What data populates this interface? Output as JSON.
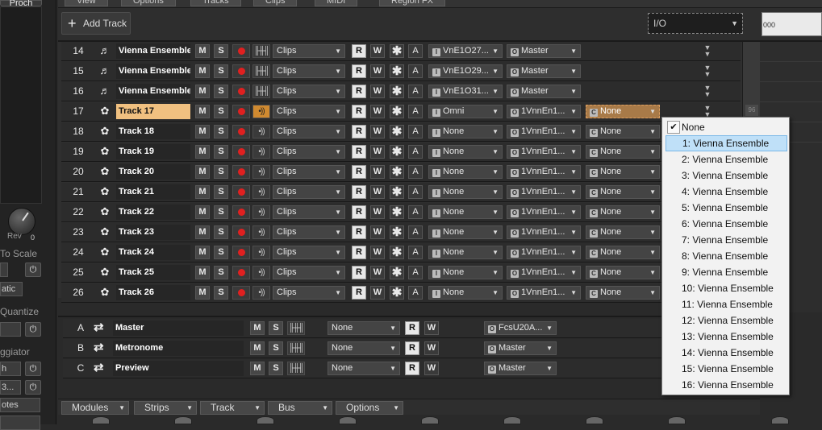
{
  "left_panel": {
    "top_label": "Proch",
    "rev_label": "Rev",
    "rev_value": "0",
    "to_scale_label": "To Scale",
    "atic_value": "atic",
    "quantize_label": "Quantize",
    "arpeggiator_label": "ggiator",
    "h_value": "h",
    "dots_value": "3...",
    "otes_value": "otes",
    "power_symbol": "⏻"
  },
  "top_menu": [
    "View",
    "Options",
    "Tracks",
    "Clips",
    "MIDI",
    "Region FX"
  ],
  "toolbar": {
    "add_track_label": "Add Track",
    "io_label": "I/O",
    "ruler_text": "000"
  },
  "buttons": {
    "mute": "M",
    "solo": "S",
    "read": "R",
    "write": "W",
    "star": "✱",
    "auto": "A",
    "clips": "Clips"
  },
  "tracks": [
    {
      "num": "14",
      "name": "Vienna Ensemble",
      "input": "VnE1O27...",
      "output": "Master",
      "channel": ""
    },
    {
      "num": "15",
      "name": "Vienna Ensemble",
      "input": "VnE1O29...",
      "output": "Master",
      "channel": ""
    },
    {
      "num": "16",
      "name": "Vienna Ensemble",
      "input": "VnE1O31...",
      "output": "Master",
      "channel": ""
    },
    {
      "num": "17",
      "name": "Track 17",
      "input": "Omni",
      "output": "1VnnEn1...",
      "channel": "None"
    },
    {
      "num": "18",
      "name": "Track 18",
      "input": "None",
      "output": "1VnnEn1...",
      "channel": "None"
    },
    {
      "num": "19",
      "name": "Track 19",
      "input": "None",
      "output": "1VnnEn1...",
      "channel": "None"
    },
    {
      "num": "20",
      "name": "Track 20",
      "input": "None",
      "output": "1VnnEn1...",
      "channel": "None"
    },
    {
      "num": "21",
      "name": "Track 21",
      "input": "None",
      "output": "1VnnEn1...",
      "channel": "None"
    },
    {
      "num": "22",
      "name": "Track 22",
      "input": "None",
      "output": "1VnnEn1...",
      "channel": "None"
    },
    {
      "num": "23",
      "name": "Track 23",
      "input": "None",
      "output": "1VnnEn1...",
      "channel": "None"
    },
    {
      "num": "24",
      "name": "Track 24",
      "input": "None",
      "output": "1VnnEn1...",
      "channel": "None"
    },
    {
      "num": "25",
      "name": "Track 25",
      "input": "None",
      "output": "1VnnEn1...",
      "channel": "None"
    },
    {
      "num": "26",
      "name": "Track 26",
      "input": "None",
      "output": "1VnnEn1...",
      "channel": "None"
    }
  ],
  "buses": [
    {
      "letter": "A",
      "name": "Master",
      "input": "None",
      "output": "FcsU20A..."
    },
    {
      "letter": "B",
      "name": "Metronome",
      "input": "None",
      "output": "Master"
    },
    {
      "letter": "C",
      "name": "Preview",
      "input": "None",
      "output": "Master"
    }
  ],
  "bottom_tabs": [
    "Modules",
    "Strips",
    "Track",
    "Bus",
    "Options"
  ],
  "dropdown_menu": {
    "items": [
      "None",
      "1: Vienna Ensemble",
      "2: Vienna Ensemble",
      "3: Vienna Ensemble",
      "4: Vienna Ensemble",
      "5: Vienna Ensemble",
      "6: Vienna Ensemble",
      "7: Vienna Ensemble",
      "8: Vienna Ensemble",
      "9: Vienna Ensemble",
      "10: Vienna Ensemble",
      "11: Vienna Ensemble",
      "12: Vienna Ensemble",
      "13: Vienna Ensemble",
      "14: Vienna Ensemble",
      "15: Vienna Ensemble",
      "16: Vienna Ensemble"
    ],
    "checked": "None",
    "highlighted": "1: Vienna Ensemble"
  },
  "scroll_number": "96",
  "colors": {
    "selected_track": "#f0c080",
    "record": "#e02020",
    "highlight": "#bfe0f8"
  }
}
